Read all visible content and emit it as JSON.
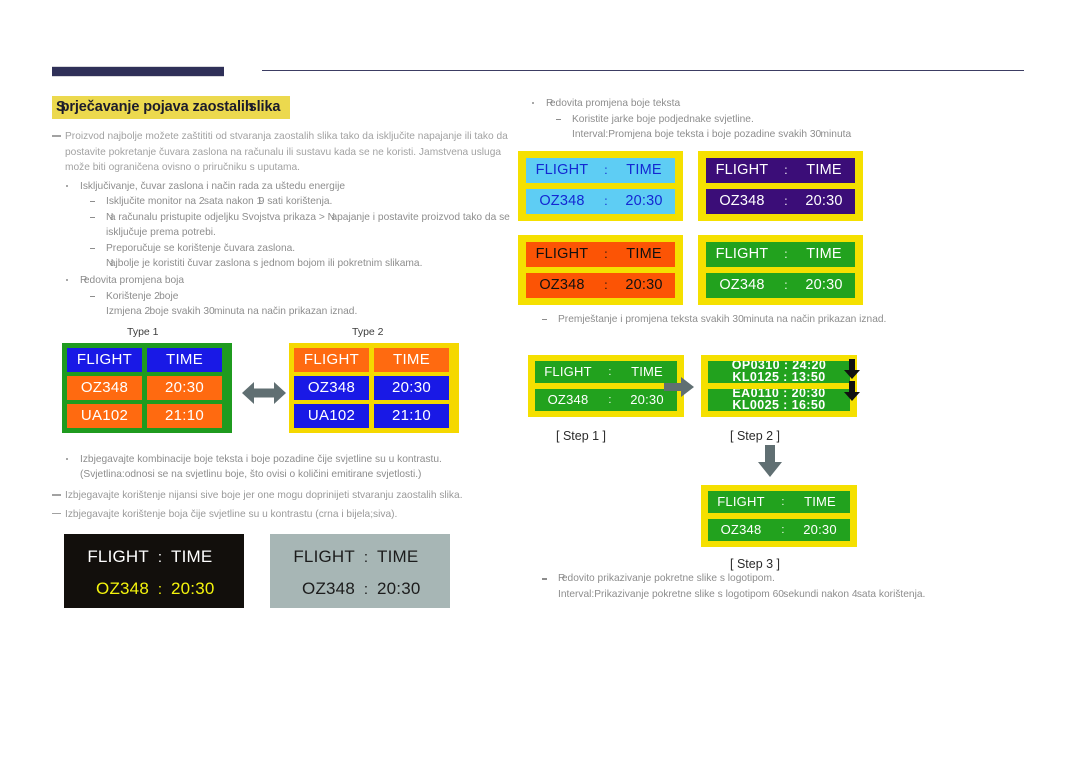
{
  "title": {
    "lead": "S",
    "main": "prječavanje pojava zaostalih",
    "tail": "slika"
  },
  "left": {
    "intro_note": "Proizvod najbolje možete zaštititi od stvaranja zaostalih slika tako da isključite napajanje ili tako da postavite pokretanje čuvara zaslona na računalu ili sustavu kada se ne koristi. Jamstvena usluga može biti ograničena ovisno o priručniku s uputama.",
    "bullet_power": "Isključivanje, čuvar zaslona i način rada za uštedu energije",
    "sub_power_1_pre": "Isključite monitor na ",
    "sub_power_1_n1": "2",
    "sub_power_1_mid": " sata nakon ",
    "sub_power_1_n2": "1",
    "sub_power_1_post": "9 sati korištenja.",
    "sub_power_2_pre": "N",
    "sub_power_2_a": "a računalu pristupite odjeljku Svojstva prikaza > ",
    "sub_power_2_b": "N",
    "sub_power_2_c": "apajanje i postavite proizvod tako da se isključuje prema potrebi.",
    "sub_power_3": "Preporučuje se korištenje čuvara zaslona.",
    "sub_power_3_cont_pre": "N",
    "sub_power_3_cont": "ajbolje je koristiti čuvar zaslona s jednom bojom ili pokretnim slikama.",
    "bullet_colors_pre": "R",
    "bullet_colors": "edovita promjena boja",
    "sub_colors_1_pre": "Korištenje ",
    "sub_colors_1_n": "2",
    "sub_colors_1_post": " boje",
    "sub_colors_2_pre": "Izmjena ",
    "sub_colors_2_n1": "2",
    "sub_colors_2_mid": " boje svakih ",
    "sub_colors_2_n2": "30",
    "sub_colors_2_post": " minuta na način prikazan iznad.",
    "bullet_contrast": "Izbjegavajte kombinacije boje teksta i boje pozadine čije svjetline su u kontrastu.",
    "bullet_contrast_cont": "(Svjetlina:odnosi se na svjetlinu boje, što ovisi o količini emitirane svjetlosti.)",
    "note_gray": "Izbjegavajte korištenje nijansi sive boje jer one mogu doprinijeti stvaranju zaostalih slika.",
    "note_bw": "Izbjegavajte korištenje boja čije svjetline su u kontrastu (crna i bijela;siva).",
    "type1_label": "Type 1",
    "type2_label": "Type 2"
  },
  "right": {
    "bullet_text_color_pre": "R",
    "bullet_text_color": "edovita promjena boje teksta",
    "sub_bright": "Koristite jarke boje podjednake svjetline.",
    "sub_interval_pre": "Interval:Promjena boje teksta i boje pozadine svakih ",
    "sub_interval_n": "30",
    "sub_interval_post": " minuta",
    "sub_move_pre": "Premještanje i promjena teksta svakih ",
    "sub_move_n": "30",
    "sub_move_post": " minuta na način prikazan iznad.",
    "bullet_logo_pre": "R",
    "bullet_logo": "edovito prikazivanje pokretne slike s logotipom.",
    "sub_logo_interval_pre": "Interval:Prikazivanje pokretne slike s logotipom ",
    "sub_logo_interval_n1": "60",
    "sub_logo_interval_mid": " sekundi nakon ",
    "sub_logo_interval_n2": "4",
    "sub_logo_interval_post": " sata korištenja.",
    "step1_caption": "[ Step 1 ]",
    "step2_caption": "[ Step 2 ]",
    "step3_caption": "[ Step 3 ]"
  },
  "board": {
    "header_flight": "FLIGHT",
    "header_time": "TIME",
    "row1_code": "OZ348",
    "row1_time": "20:30",
    "row2_code": "UA102",
    "row2_time": "21:10",
    "separator": ":"
  },
  "scroll": {
    "r1_up": "OP0310 : 24:20",
    "r1_down": "KL0125 : 13:50",
    "r2_up": "EA0110 : 20:30",
    "r2_down": "KL0025 : 16:50"
  },
  "colors": {
    "title_highlight": "#ecd94e",
    "header_bar": "#2f3058",
    "green": "#1f9b1f",
    "yellow": "#f5d800",
    "blue": "#1919e6",
    "orange": "#ff6a10",
    "purple": "#3b0d78",
    "cyan": "#5ecdf4",
    "panel_dark": "#120f0c",
    "panel_gray": "#a7b6b5",
    "panel_yellow_text": "#f4f40c",
    "arrow_gray": "#606f72"
  }
}
